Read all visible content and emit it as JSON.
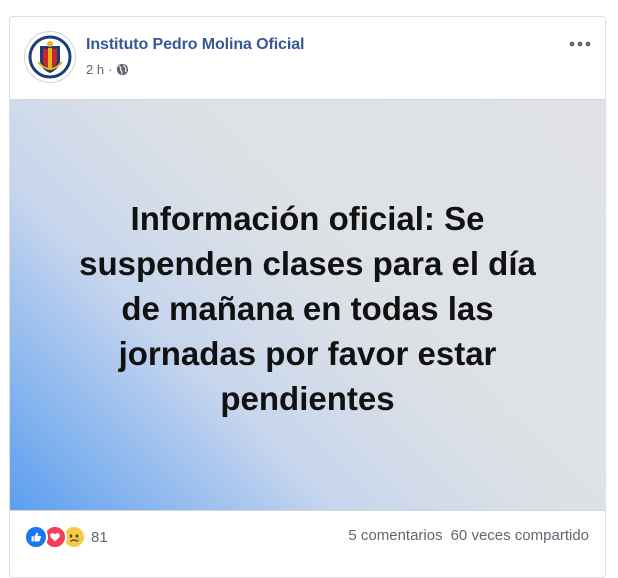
{
  "post": {
    "page_name": "Instituto Pedro Molina Oficial",
    "time": "2 h",
    "separator": "·",
    "audience_icon": "globe-icon",
    "more_icon": "more-options-icon",
    "image_text": "Información oficial: Se suspenden clases para el día de mañana en todas las jornadas por favor estar pendientes",
    "colors": {
      "page_name": "#385898",
      "gradient_start": "#5c9ef0",
      "gradient_end": "#e0e2e5",
      "like": "#1877f2",
      "love": "#f33e58",
      "sad": "#f7c948"
    }
  },
  "footer": {
    "reactions": [
      "like-icon",
      "love-icon",
      "sad-icon"
    ],
    "reaction_count": "81",
    "comments": "5 comentarios",
    "shares": "60 veces compartido"
  }
}
